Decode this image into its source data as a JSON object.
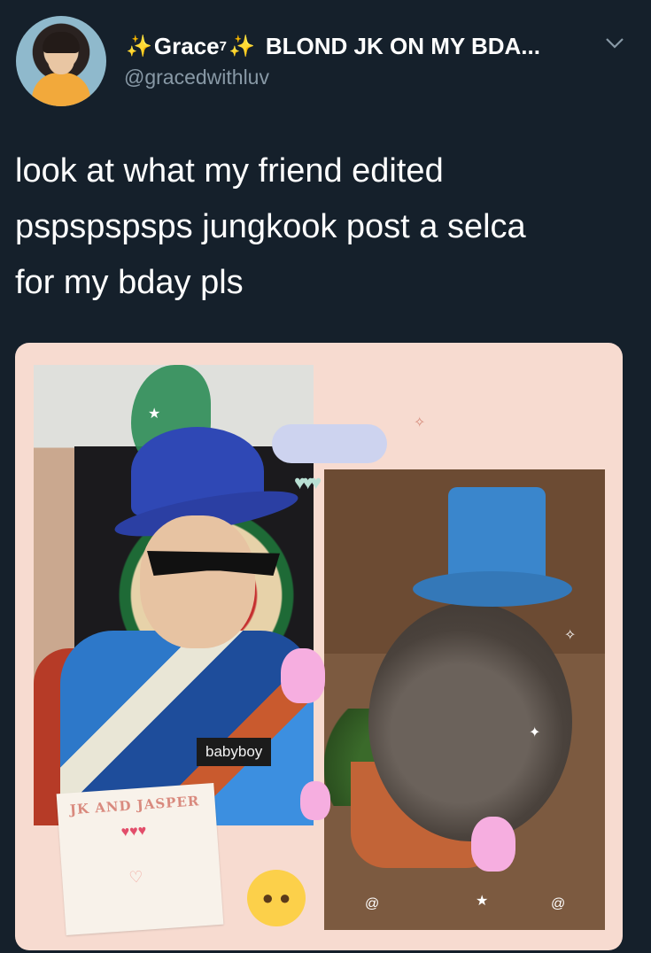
{
  "tweet": {
    "display_name_prefix_icon": "sparkles",
    "display_name": "Grace",
    "display_name_sup": "7",
    "display_name_suffix": "BLOND JK ON MY BDA...",
    "handle": "@gracedwithluv",
    "text_lines": [
      "look at what my friend edited",
      "pspspspsps jungkook post a selca",
      "for my bday pls"
    ],
    "menu_icon": "chevron-down-icon"
  },
  "media": {
    "caption": "babyboy",
    "note_title": "JK AND JASPER"
  },
  "colors": {
    "background": "#15202b",
    "secondary_text": "#8899a6",
    "accent_sparkle": "#f5c542"
  }
}
